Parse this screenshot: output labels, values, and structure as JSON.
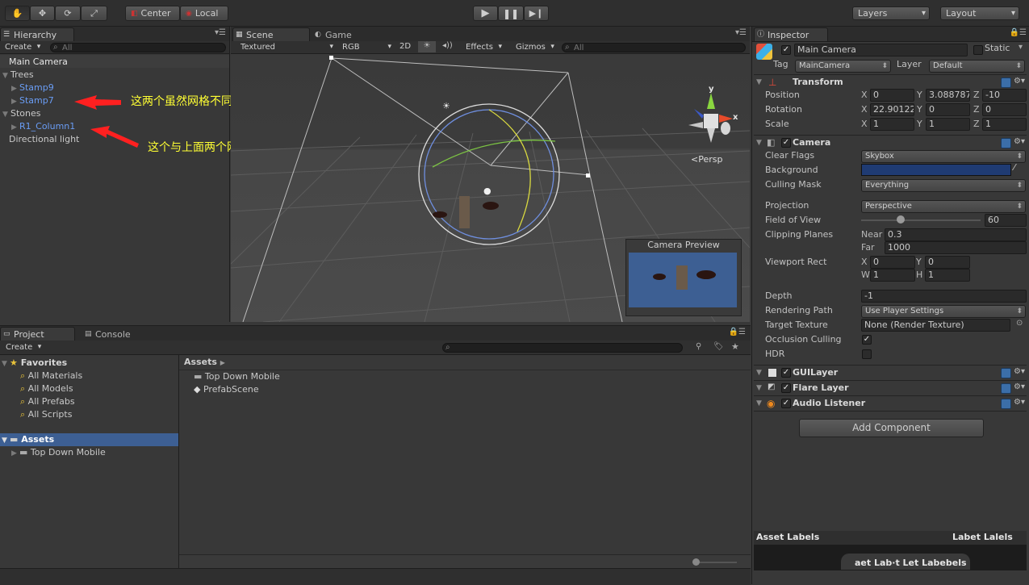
{
  "toolbar": {
    "pivot": "Center",
    "space": "Local",
    "layers": "Layers",
    "layout": "Layout"
  },
  "hierarchy": {
    "tab": "Hierarchy",
    "create": "Create",
    "search": "All",
    "items": [
      {
        "label": "Main Camera"
      },
      {
        "label": "Trees"
      },
      {
        "label": "Stamp9"
      },
      {
        "label": "Stamp7"
      },
      {
        "label": "Stones"
      },
      {
        "label": "R1_Column1"
      },
      {
        "label": "Directional light"
      }
    ]
  },
  "annotations": {
    "note1": "这两个虽然网格不同，但是材质相同",
    "note2": "这个与上面两个网格材质都不相同"
  },
  "scene": {
    "tabs": [
      "Scene",
      "Game"
    ],
    "textured": "Textured",
    "rgb": "RGB",
    "mode2d": "2D",
    "effects": "Effects",
    "gizmos": "Gizmos",
    "search": "All",
    "persp": "Persp",
    "gizmo_x": "x",
    "gizmo_y": "y",
    "camera_preview": "Camera Preview"
  },
  "project": {
    "tabs": [
      "Project",
      "Console"
    ],
    "create": "Create",
    "favorites_label": "Favorites",
    "favorites": [
      "All Materials",
      "All Models",
      "All Prefabs",
      "All Scripts"
    ],
    "assets_label": "Assets",
    "assets_children": [
      "Top Down Mobile"
    ],
    "breadcrumb": "Assets",
    "content": [
      "Top Down Mobile",
      "PrefabScene"
    ]
  },
  "inspector": {
    "tab": "Inspector",
    "object_name": "Main Camera",
    "static": "Static",
    "tag_label": "Tag",
    "tag": "MainCamera",
    "layer_label": "Layer",
    "layer": "Default",
    "transform": {
      "title": "Transform",
      "position_label": "Position",
      "rotation_label": "Rotation",
      "scale_label": "Scale",
      "position": [
        "0",
        "3.088787",
        "-10"
      ],
      "rotation": [
        "22.90122",
        "0",
        "0"
      ],
      "scale": [
        "1",
        "1",
        "1"
      ]
    },
    "camera": {
      "title": "Camera",
      "clear_flags_label": "Clear Flags",
      "clear_flags": "Skybox",
      "background_label": "Background",
      "culling_mask_label": "Culling Mask",
      "culling_mask": "Everything",
      "projection_label": "Projection",
      "projection": "Perspective",
      "fov_label": "Field of View",
      "fov": "60",
      "clipping_label": "Clipping Planes",
      "near_label": "Near",
      "near": "0.3",
      "far_label": "Far",
      "far": "1000",
      "viewport_label": "Viewport Rect",
      "vx": "0",
      "vy": "0",
      "vw": "1",
      "vh": "1",
      "depth_label": "Depth",
      "depth": "-1",
      "rendering_path_label": "Rendering Path",
      "rendering_path": "Use Player Settings",
      "target_texture_label": "Target Texture",
      "target_texture": "None (Render Texture)",
      "occlusion_label": "Occlusion Culling",
      "hdr_label": "HDR"
    },
    "components": [
      "GUILayer",
      "Flare Layer",
      "Audio Listener"
    ],
    "add_component": "Add Component",
    "asset_labels": "Asset Labels",
    "labels_right": "Labet Lalels",
    "labels_bottom": "aet Lab·t Let Labebels"
  },
  "colors": {
    "accent": "#3d5f93",
    "background_swatch": "#1f3b73",
    "annotation": "#ffff33",
    "arrow": "#ff2020"
  }
}
